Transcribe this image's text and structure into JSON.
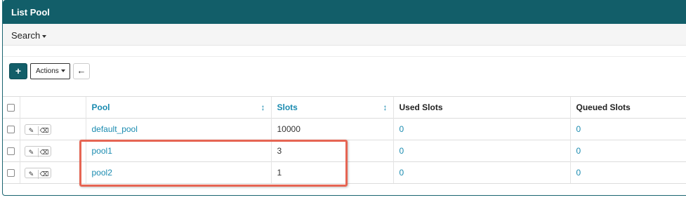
{
  "panel": {
    "title": "List Pool"
  },
  "search": {
    "label": "Search"
  },
  "toolbar": {
    "add_label": "+",
    "actions_label": "Actions",
    "back_icon": "arrow-left-icon"
  },
  "table": {
    "headers": {
      "pool": "Pool",
      "slots": "Slots",
      "used_slots": "Used Slots",
      "queued_slots": "Queued Slots"
    },
    "rows": [
      {
        "pool": "default_pool",
        "slots": "10000",
        "used_slots": "0",
        "queued_slots": "0"
      },
      {
        "pool": "pool1",
        "slots": "3",
        "used_slots": "0",
        "queued_slots": "0"
      },
      {
        "pool": "pool2",
        "slots": "1",
        "used_slots": "0",
        "queued_slots": "0"
      }
    ]
  },
  "colors": {
    "header_bg": "#125e69",
    "link": "#1a8bb0",
    "highlight": "#e66553"
  }
}
